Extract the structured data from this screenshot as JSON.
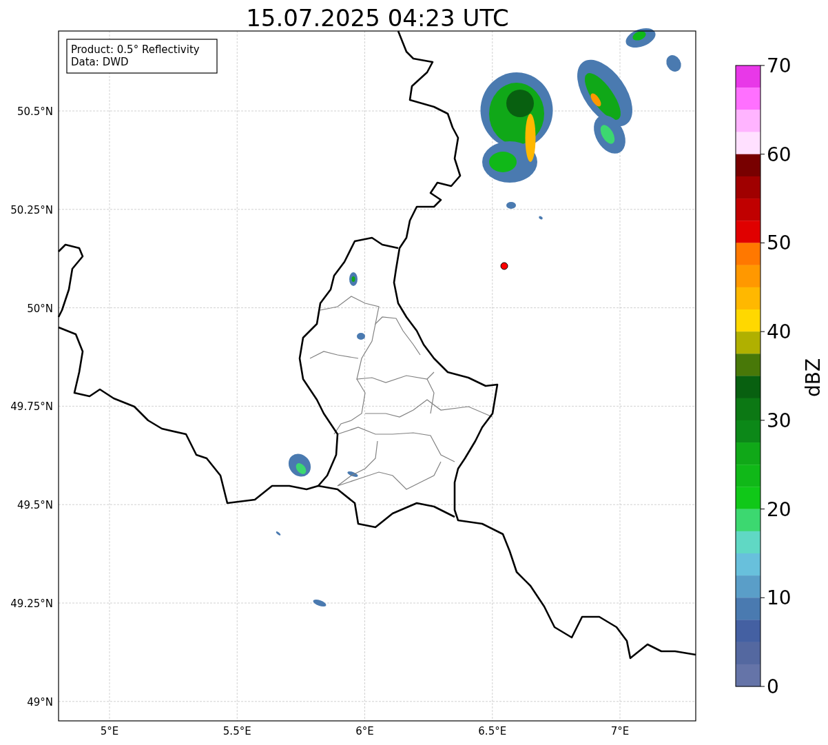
{
  "title": "15.07.2025 04:23 UTC",
  "info_box": [
    "Product: 0.5° Reflectivity",
    "Data: DWD"
  ],
  "map": {
    "x_ticks": [
      "5°E",
      "5.5°E",
      "6°E",
      "6.5°E",
      "7°E"
    ],
    "y_ticks": [
      "50.5°N",
      "50.25°N",
      "50°N",
      "49.75°N",
      "49.5°N",
      "49.25°N",
      "49°N"
    ]
  },
  "colorbar": {
    "label": "dBZ",
    "ticks": [
      "70",
      "60",
      "50",
      "40",
      "30",
      "20",
      "10",
      "0"
    ],
    "bins": [
      {
        "color": "#e838e8"
      },
      {
        "color": "#ff70ff"
      },
      {
        "color": "#ffb4ff"
      },
      {
        "color": "#ffe0ff"
      },
      {
        "color": "#780000"
      },
      {
        "color": "#a00000"
      },
      {
        "color": "#c00000"
      },
      {
        "color": "#e00000"
      },
      {
        "color": "#ff7800"
      },
      {
        "color": "#ff9800"
      },
      {
        "color": "#ffb800"
      },
      {
        "color": "#ffd800"
      },
      {
        "color": "#b0b000"
      },
      {
        "color": "#487808"
      },
      {
        "color": "#086010"
      },
      {
        "color": "#0c7814"
      },
      {
        "color": "#0c8818"
      },
      {
        "color": "#10a818"
      },
      {
        "color": "#10b818"
      },
      {
        "color": "#10c818"
      },
      {
        "color": "#3cd870"
      },
      {
        "color": "#60d8c4"
      },
      {
        "color": "#68c0dc"
      },
      {
        "color": "#5a9ec8"
      },
      {
        "color": "#4a7ab0"
      },
      {
        "color": "#4460a2"
      },
      {
        "color": "#5468a0"
      },
      {
        "color": "#6574a8"
      }
    ]
  }
}
